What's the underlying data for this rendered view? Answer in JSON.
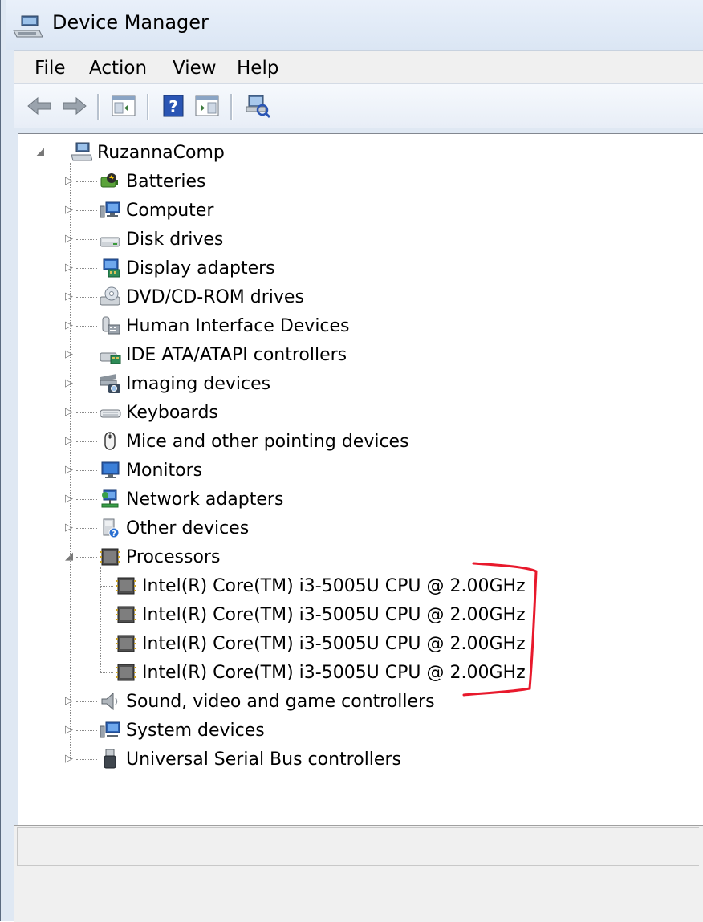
{
  "window": {
    "title": "Device Manager"
  },
  "menu": [
    "File",
    "Action",
    "View",
    "Help"
  ],
  "toolbar": {
    "buttons": [
      {
        "name": "back-arrow-icon"
      },
      {
        "name": "forward-arrow-icon"
      },
      {
        "name": "show-hide-console-tree-icon"
      },
      {
        "name": "help-icon"
      },
      {
        "name": "show-action-pane-icon"
      },
      {
        "name": "scan-hardware-changes-icon"
      }
    ]
  },
  "tree": {
    "root": {
      "label": "RuzannaComp",
      "icon": "computer-root-icon",
      "expanded": true
    },
    "categories": [
      {
        "label": "Batteries",
        "icon": "battery-icon"
      },
      {
        "label": "Computer",
        "icon": "computer-icon"
      },
      {
        "label": "Disk drives",
        "icon": "disk-drive-icon"
      },
      {
        "label": "Display adapters",
        "icon": "display-adapter-icon"
      },
      {
        "label": "DVD/CD-ROM drives",
        "icon": "dvd-drive-icon"
      },
      {
        "label": "Human Interface Devices",
        "icon": "hid-icon"
      },
      {
        "label": "IDE ATA/ATAPI controllers",
        "icon": "ide-controller-icon"
      },
      {
        "label": "Imaging devices",
        "icon": "imaging-device-icon"
      },
      {
        "label": "Keyboards",
        "icon": "keyboard-icon"
      },
      {
        "label": "Mice and other pointing devices",
        "icon": "mouse-icon"
      },
      {
        "label": "Monitors",
        "icon": "monitor-icon"
      },
      {
        "label": "Network adapters",
        "icon": "network-adapter-icon"
      },
      {
        "label": "Other devices",
        "icon": "other-devices-icon"
      },
      {
        "label": "Processors",
        "icon": "processor-icon",
        "expanded": true,
        "children": [
          "Intel(R) Core(TM) i3-5005U CPU @ 2.00GHz",
          "Intel(R) Core(TM) i3-5005U CPU @ 2.00GHz",
          "Intel(R) Core(TM) i3-5005U CPU @ 2.00GHz",
          "Intel(R) Core(TM) i3-5005U CPU @ 2.00GHz"
        ]
      },
      {
        "label": "Sound, video and game controllers",
        "icon": "speaker-icon"
      },
      {
        "label": "System devices",
        "icon": "system-devices-icon"
      },
      {
        "label": "Universal Serial Bus controllers",
        "icon": "usb-icon"
      }
    ]
  },
  "colors": {
    "highlight_mark": "#e8192c",
    "tree_background": "#ffffff"
  },
  "annotation": {
    "type": "red bracket around processor entries"
  }
}
